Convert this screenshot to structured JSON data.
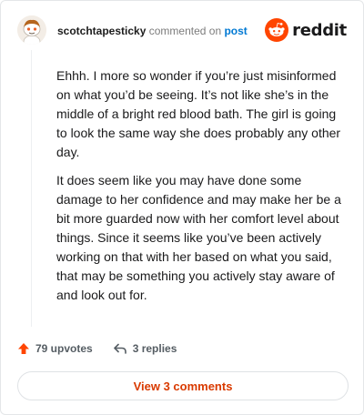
{
  "header": {
    "username": "scotchtapesticky",
    "commented_text": "commented on",
    "post_link": "post",
    "brand_name": "reddit"
  },
  "comment": {
    "paragraphs": [
      "Ehhh. I more so wonder if you’re just misinformed on what you’d be seeing. It’s not like she’s in the middle of a bright red blood bath. The girl is going to look the same way she does probably any other day.",
      "It does seem like you may have done some damage to her confidence and may make her be a bit more guarded now with her comfort level about things. Since it seems like you’ve been actively working on that with her based on what you said, that may be something you actively stay aware of and look out for."
    ]
  },
  "actions": {
    "upvotes_label": "79 upvotes",
    "replies_label": "3 replies"
  },
  "footer": {
    "view_comments_label": "View 3 comments"
  },
  "icons": {
    "upvote": "upvote-arrow-icon",
    "reply": "reply-arrow-icon",
    "brand": "reddit-snoo-icon"
  },
  "colors": {
    "accent": "#ff4500",
    "view_button_text": "#d93a00",
    "link": "#0079d3"
  }
}
